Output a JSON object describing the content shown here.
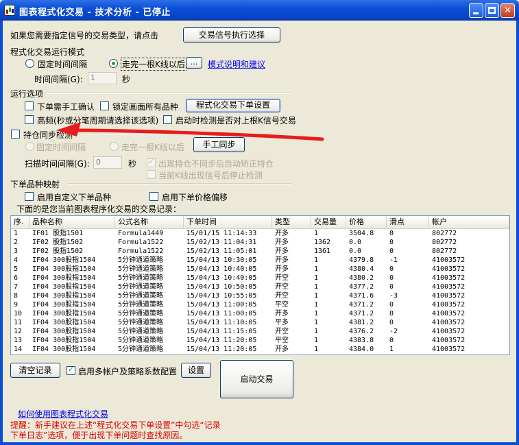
{
  "window": {
    "title": "图表程式化交易 - 技术分析 - 已停止",
    "min_label": "",
    "max_label": "",
    "close_label": "✕"
  },
  "signal": {
    "prompt": "如果您需要指定信号的交易类型，请点击",
    "button": "交易信号执行选择"
  },
  "run_mode": {
    "heading": "程式化交易运行模式",
    "fixed_interval": "固定时间间隔",
    "after_kline": "走完一根K线以后",
    "more_button": "...",
    "help_link": "模式说明和建议",
    "interval_label": "时间间隔(G):",
    "interval_value": "1",
    "interval_unit": "秒",
    "selected": "after_kline"
  },
  "run_options": {
    "heading": "运行选项",
    "manual_confirm": "下单需手工确认",
    "lock_products": "锁定画面所有品种",
    "order_settings_button": "程式化交易下单设置",
    "high_freq": "高频(秒或分笔周期请选择该选项)",
    "check_on_start": "启动时检测是否对上根K信号交易"
  },
  "position_sync": {
    "checkbox": "持仓同步检测",
    "fixed_interval": "固定时间间隔",
    "after_kline": "走完一根K线以后",
    "manual_sync_button": "手工同步",
    "scan_label": "扫描时间间隔(G):",
    "scan_value": "0",
    "scan_unit": "秒",
    "auto_fix": "出现持仓不同步后自动矫正持仓",
    "stop_on_signal": "当前K线出现信号后停止检测"
  },
  "order_mapping": {
    "heading": "下单品种映射",
    "custom_product": "启用自定义下单品种",
    "price_offset": "启用下单价格偏移"
  },
  "records": {
    "caption": "下面的是您当前图表程序化交易的交易记录：",
    "columns": [
      "序.",
      "品种名称",
      "公式名称",
      "下单时间",
      "类型",
      "交易量",
      "价格",
      "滑点",
      "帐户"
    ],
    "rows": [
      [
        "1",
        "IF01 股指1501",
        "Formula1449",
        "15/01/15 11:14:33",
        "开多",
        "1",
        "3504.8",
        "0",
        "802772"
      ],
      [
        "2",
        "IF02 股指1502",
        "Formula1522",
        "15/02/13 11:04:31",
        "开多",
        "1362",
        "0.0",
        "0",
        "802772"
      ],
      [
        "3",
        "IF02 股指1502",
        "Formula1522",
        "15/02/13 11:05:01",
        "开多",
        "1361",
        "0.0",
        "0",
        "802772"
      ],
      [
        "4",
        "IF04 300股指1504",
        "5分钟通道策略",
        "15/04/13 10:30:05",
        "开多",
        "1",
        "4379.8",
        "-1",
        "41003572"
      ],
      [
        "5",
        "IF04 300股指1504",
        "5分钟通道策略",
        "15/04/13 10:40:05",
        "开多",
        "1",
        "4380.4",
        "0",
        "41003572"
      ],
      [
        "6",
        "IF04 300股指1504",
        "5分钟通道策略",
        "15/04/13 10:40:05",
        "开空",
        "1",
        "4380.2",
        "0",
        "41003572"
      ],
      [
        "7",
        "IF04 300股指1504",
        "5分钟通道策略",
        "15/04/13 10:50:05",
        "开空",
        "1",
        "4377.2",
        "0",
        "41003572"
      ],
      [
        "8",
        "IF04 300股指1504",
        "5分钟通道策略",
        "15/04/13 10:55:05",
        "开空",
        "1",
        "4371.6",
        "-3",
        "41003572"
      ],
      [
        "9",
        "IF04 300股指1504",
        "5分钟通道策略",
        "15/04/13 11:00:05",
        "平空",
        "1",
        "4371.2",
        "0",
        "41003572"
      ],
      [
        "10",
        "IF04 300股指1504",
        "5分钟通道策略",
        "15/04/13 11:00:05",
        "开多",
        "1",
        "4371.2",
        "0",
        "41003572"
      ],
      [
        "11",
        "IF04 300股指1504",
        "5分钟通道策略",
        "15/04/13 11:10:05",
        "平多",
        "1",
        "4381.2",
        "0",
        "41003572"
      ],
      [
        "12",
        "IF04 300股指1504",
        "5分钟通道策略",
        "15/04/13 11:15:05",
        "开空",
        "1",
        "4376.2",
        "-2",
        "41003572"
      ],
      [
        "13",
        "IF04 300股指1504",
        "5分钟通道策略",
        "15/04/13 11:20:05",
        "平空",
        "1",
        "4383.8",
        "0",
        "41003572"
      ],
      [
        "14",
        "IF04 300股指1504",
        "5分钟通道策略",
        "15/04/13 11:20:05",
        "开多",
        "1",
        "4384.0",
        "1",
        "41003572"
      ]
    ]
  },
  "bottom": {
    "clear_button": "清空记录",
    "multi_account": "启用多帐户及策略系数配置",
    "settings_button": "设置",
    "start_button": "启动交易",
    "howto_link": "如何使用图表程式化交易",
    "hint_line1": "提醒：新手建议在上述“程式化交易下单设置”中勾选“记录",
    "hint_line2": "下单日志”选项，便于出现下单问题时查找原因。"
  },
  "colors": {
    "titlebar": "#0a50d8",
    "dialog_bg": "#ece9d8",
    "hint_red": "#e00000",
    "annotation_arrow": "#e81c1c",
    "link_blue": "#0000ee"
  }
}
